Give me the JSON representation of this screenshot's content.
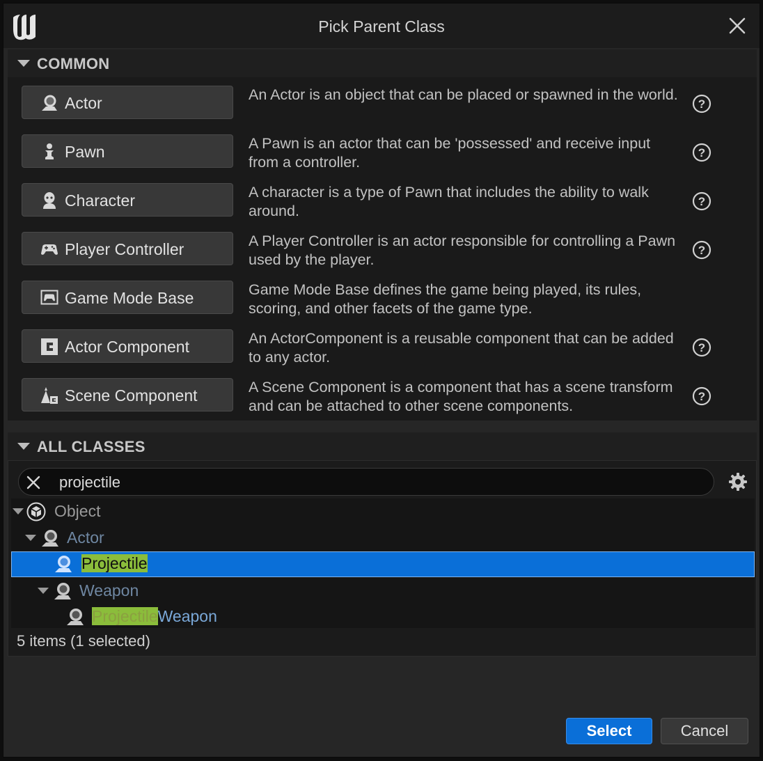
{
  "window": {
    "title": "Pick Parent Class"
  },
  "common": {
    "header": "COMMON",
    "items": [
      {
        "label": "Actor",
        "icon": "actor-icon",
        "description": "An Actor is an object that can be placed or spawned in the world.",
        "help": true
      },
      {
        "label": "Pawn",
        "icon": "pawn-icon",
        "description": "A Pawn is an actor that can be 'possessed' and receive input from a controller.",
        "help": true
      },
      {
        "label": "Character",
        "icon": "character-icon",
        "description": "A character is a type of Pawn that includes the ability to walk around.",
        "help": true
      },
      {
        "label": "Player Controller",
        "icon": "gamepad-icon",
        "description": "A Player Controller is an actor responsible for controlling a Pawn used by the player.",
        "help": true
      },
      {
        "label": "Game Mode Base",
        "icon": "game-mode-icon",
        "description": "Game Mode Base defines the game being played, its rules, scoring, and other facets of the game type.",
        "help": false
      },
      {
        "label": "Actor Component",
        "icon": "actor-component-icon",
        "description": "An ActorComponent is a reusable component that can be added to any actor.",
        "help": true
      },
      {
        "label": "Scene Component",
        "icon": "scene-component-icon",
        "description": "A Scene Component is a component that has a scene transform and can be attached to other scene components.",
        "help": true
      }
    ]
  },
  "all_classes": {
    "header": "ALL CLASSES",
    "search": {
      "value": "projectile"
    },
    "tree": [
      {
        "label": "Object",
        "depth": 0,
        "expanded": true,
        "icon": "object-icon",
        "dim": false
      },
      {
        "label": "Actor",
        "depth": 1,
        "expanded": true,
        "icon": "actor-icon",
        "dim": true
      },
      {
        "label": "Projectile",
        "depth": 2,
        "expanded": false,
        "icon": "actor-icon",
        "selected": true
      },
      {
        "label": "Weapon",
        "depth": 2,
        "expanded": true,
        "icon": "actor-icon",
        "dim": true
      },
      {
        "label_match": "Projectile",
        "label_rest": "Weapon",
        "depth": 3,
        "icon": "actor-icon"
      }
    ],
    "status": "5 items (1 selected)"
  },
  "buttons": {
    "select": "Select",
    "cancel": "Cancel"
  },
  "colors": {
    "accent": "#0a6fd8",
    "highlight": "#8bbd3b",
    "background": "#262626"
  }
}
